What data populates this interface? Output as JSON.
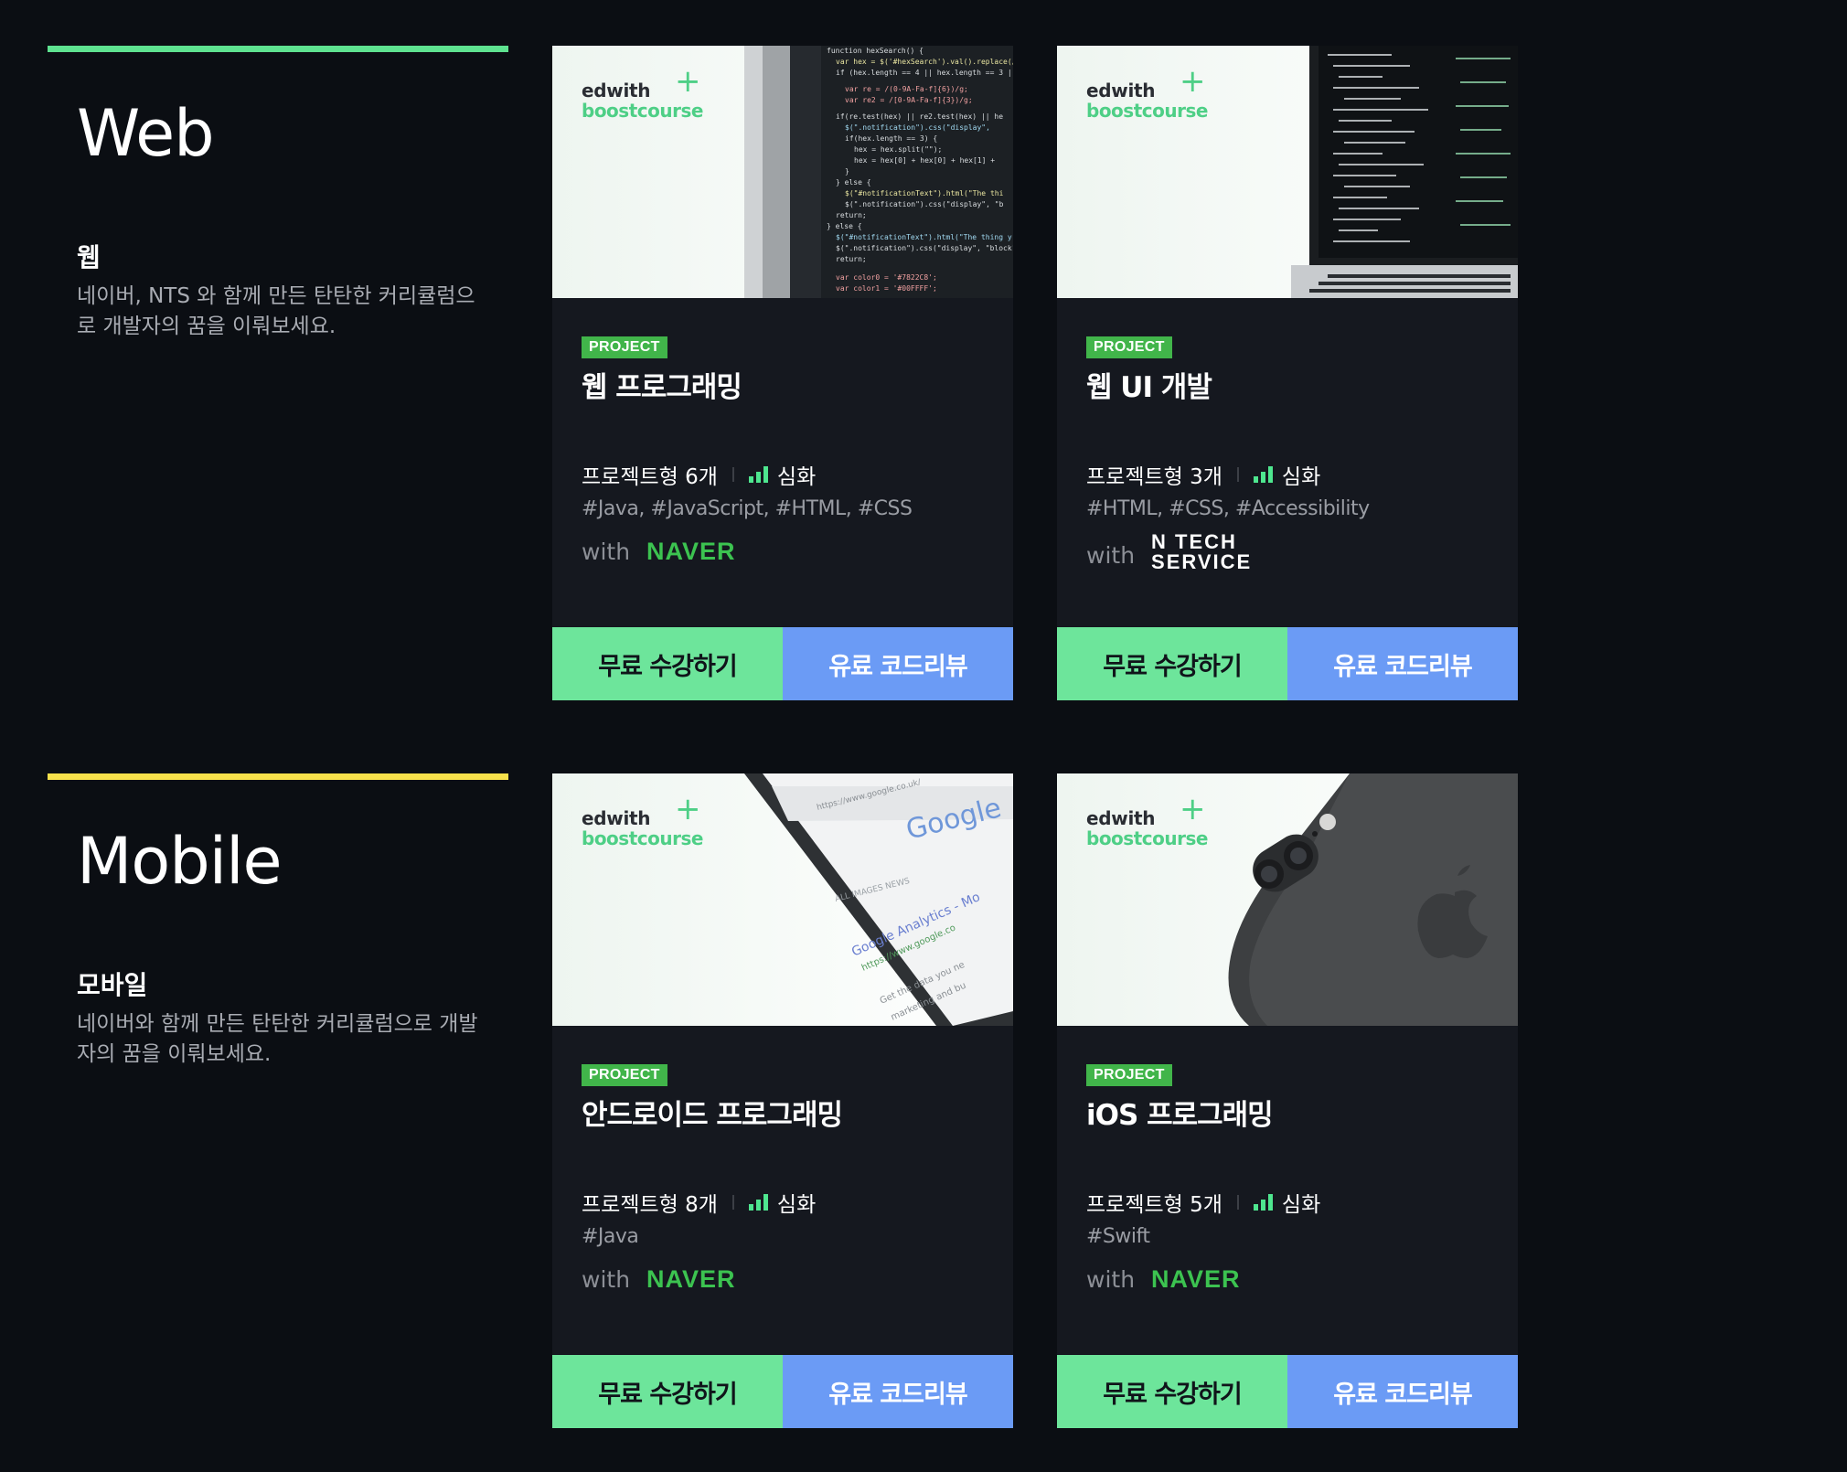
{
  "sections": [
    {
      "title": "Web",
      "subtitle": "웹",
      "description": "네이버, NTS 와 함께 만든 탄탄한 커리큘럼으로 개발자의 꿈을 이뤄보세요.",
      "accent_color": "#5ee290",
      "courses": [
        {
          "logo_top": "edwith",
          "logo_bottom": "boostcourse",
          "badge": "PROJECT",
          "title": "웹 프로그래밍",
          "projects": "프로젝트형 6개",
          "level": "심화",
          "tags": "#Java, #JavaScript, #HTML, #CSS",
          "with_label": "with",
          "partner": "NAVER",
          "free_button": "무료 수강하기",
          "paid_button": "유료 코드리뷰",
          "image": "code-on-monitor"
        },
        {
          "logo_top": "edwith",
          "logo_bottom": "boostcourse",
          "badge": "PROJECT",
          "title": "웹 UI 개발",
          "projects": "프로젝트형 3개",
          "level": "심화",
          "tags": "#HTML, #CSS, #Accessibility",
          "with_label": "with",
          "partner_line1": "N TECH",
          "partner_line2": "SERVICE",
          "free_button": "무료 수강하기",
          "paid_button": "유료 코드리뷰",
          "image": "laptop-with-code"
        }
      ]
    },
    {
      "title": "Mobile",
      "subtitle": "모바일",
      "description": "네이버와 함께 만든 탄탄한 커리큘럼으로 개발자의 꿈을 이뤄보세요.",
      "accent_color": "#f7e14b",
      "courses": [
        {
          "logo_top": "edwith",
          "logo_bottom": "boostcourse",
          "badge": "PROJECT",
          "title": "안드로이드 프로그래밍",
          "projects": "프로젝트형 8개",
          "level": "심화",
          "tags": "#Java",
          "with_label": "with",
          "partner": "NAVER",
          "free_button": "무료 수강하기",
          "paid_button": "유료 코드리뷰",
          "image": "phone-with-google"
        },
        {
          "logo_top": "edwith",
          "logo_bottom": "boostcourse",
          "badge": "PROJECT",
          "title": "iOS 프로그래밍",
          "projects": "프로젝트형 5개",
          "level": "심화",
          "tags": "#Swift",
          "with_label": "with",
          "partner": "NAVER",
          "free_button": "무료 수강하기",
          "paid_button": "유료 코드리뷰",
          "image": "iphone-back-camera"
        }
      ]
    }
  ]
}
